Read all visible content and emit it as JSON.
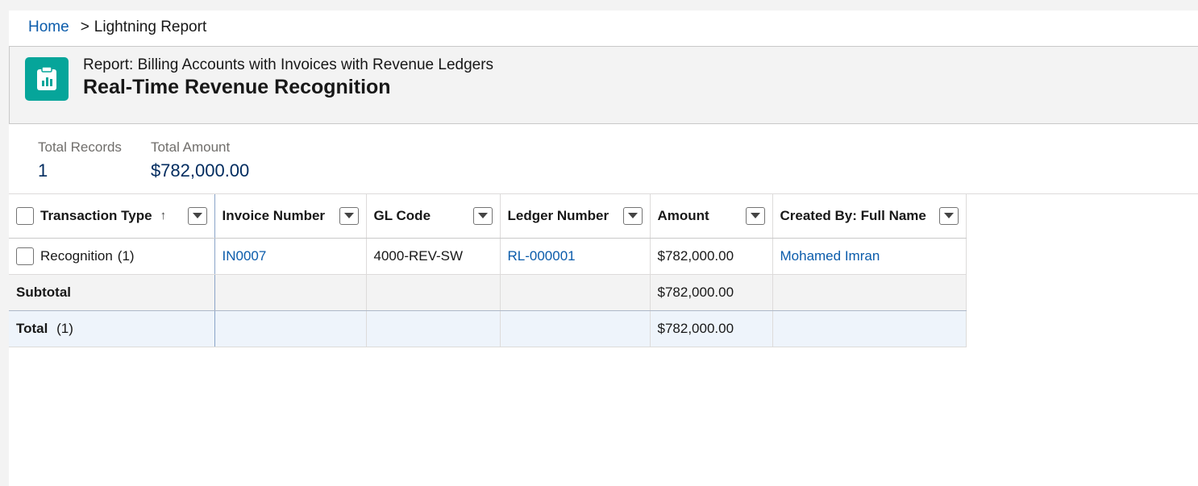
{
  "breadcrumb": {
    "home": "Home",
    "separator": ">",
    "current": "Lightning Report"
  },
  "header": {
    "icon": "report-icon",
    "subtitle": "Report: Billing Accounts with Invoices with Revenue Ledgers",
    "title": "Real-Time Revenue Recognition",
    "icon_color": "#06a59a"
  },
  "summary": {
    "total_records_label": "Total Records",
    "total_records_value": "1",
    "total_amount_label": "Total Amount",
    "total_amount_value": "$782,000.00"
  },
  "table": {
    "columns": [
      {
        "label": "Transaction Type",
        "sort": "ascending"
      },
      {
        "label": "Invoice Number"
      },
      {
        "label": "GL Code"
      },
      {
        "label": "Ledger Number"
      },
      {
        "label": "Amount"
      },
      {
        "label": "Created By: Full Name"
      }
    ],
    "group": {
      "label": "Recognition",
      "count": "(1)"
    },
    "row": {
      "invoice_number": "IN0007",
      "gl_code": "4000-REV-SW",
      "ledger_number": "RL-000001",
      "amount": "$782,000.00",
      "created_by": "Mohamed Imran"
    },
    "subtotal": {
      "label": "Subtotal",
      "amount": "$782,000.00"
    },
    "total": {
      "label": "Total",
      "count": "(1)",
      "amount": "$782,000.00"
    }
  },
  "colors": {
    "link": "#0b5cab",
    "summary_value": "#032d60",
    "total_row_bg": "#eef4fb"
  }
}
